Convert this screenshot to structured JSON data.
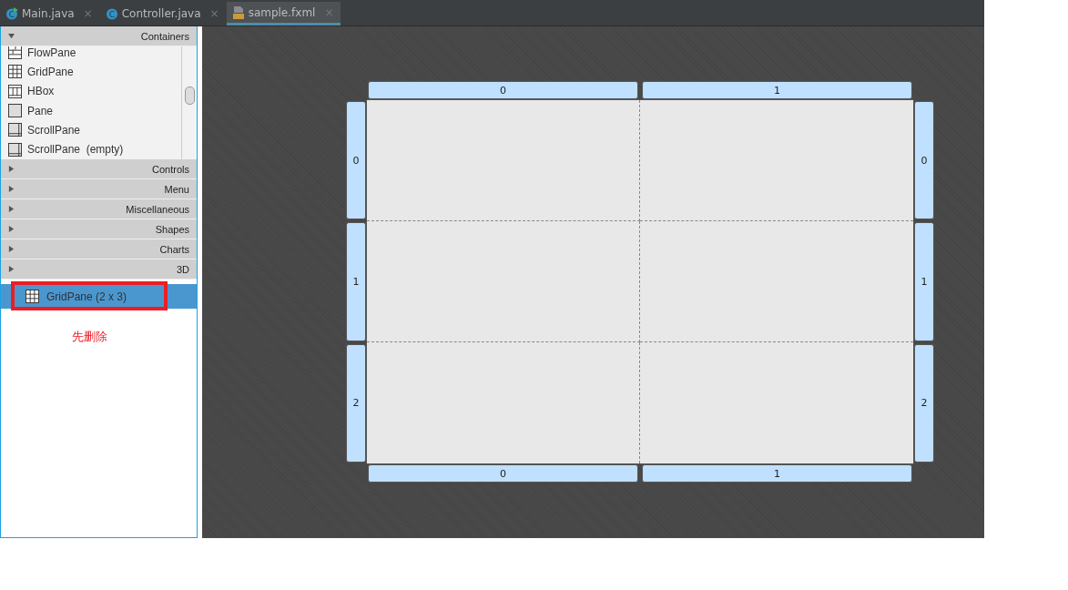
{
  "tabs": [
    {
      "label": "Main.java",
      "kind": "main-class",
      "icon_text": "C",
      "close": "×",
      "selected": false
    },
    {
      "label": "Controller.java",
      "kind": "class",
      "icon_text": "C",
      "close": "×",
      "selected": false
    },
    {
      "label": "sample.fxml",
      "kind": "fxml",
      "close": "×",
      "selected": true
    }
  ],
  "palette": {
    "sections": [
      {
        "title": "Containers",
        "expanded": true,
        "items": [
          {
            "label": "FlowPane",
            "kind": "flow"
          },
          {
            "label": "GridPane",
            "kind": "grid"
          },
          {
            "label": "HBox",
            "kind": "hbox"
          },
          {
            "label": "Pane",
            "kind": "pane"
          },
          {
            "label": "ScrollPane",
            "kind": "scroll"
          },
          {
            "label": "ScrollPane  (empty)",
            "kind": "scroll"
          }
        ]
      },
      {
        "title": "Controls",
        "expanded": false
      },
      {
        "title": "Menu",
        "expanded": false
      },
      {
        "title": "Miscellaneous",
        "expanded": false
      },
      {
        "title": "Shapes",
        "expanded": false
      },
      {
        "title": "Charts",
        "expanded": false
      },
      {
        "title": "3D",
        "expanded": false
      }
    ]
  },
  "hierarchy": {
    "items": [
      {
        "label": "GridPane (2 x 3)",
        "selected": true
      }
    ],
    "annotation": "先删除"
  },
  "grid": {
    "top_headers": [
      "0",
      "1"
    ],
    "bottom_headers": [
      "0",
      "1"
    ],
    "left_headers": [
      "0",
      "1",
      "2"
    ],
    "right_headers": [
      "0",
      "1",
      "2"
    ]
  }
}
